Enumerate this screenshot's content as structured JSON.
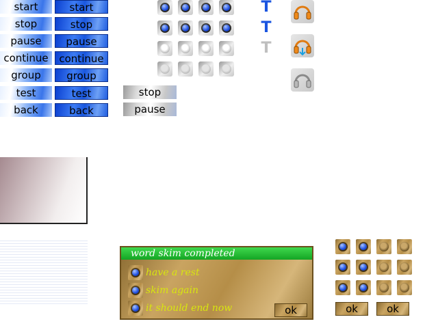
{
  "blue_buttons": {
    "left_column": [
      "start",
      "stop",
      "pause",
      "continue",
      "group",
      "test",
      "back"
    ],
    "right_column": [
      "start",
      "stop",
      "pause",
      "continue",
      "group",
      "test",
      "back"
    ]
  },
  "silver_buttons": [
    "stop",
    "pause"
  ],
  "radio_states": {
    "rows": [
      [
        "selected",
        "selected",
        "selected",
        "selected"
      ],
      [
        "selected",
        "selected",
        "selected",
        "selected"
      ],
      [
        "empty",
        "empty",
        "empty",
        "empty"
      ],
      [
        "disabled",
        "disabled",
        "disabled",
        "disabled"
      ]
    ]
  },
  "t_icons": {
    "glyph": "T",
    "states": [
      "normal",
      "hover",
      "disabled"
    ],
    "colors": [
      "#1a55e0",
      "#1a55e0",
      "#bfbfbf"
    ]
  },
  "headphone_icons": [
    "headphones-orange-icon",
    "headphones-orange-cursor-icon",
    "headphones-gray-icon"
  ],
  "dialog": {
    "title": "word skim completed",
    "options": [
      "have a rest",
      "skim again",
      "it should end now"
    ],
    "ok_label": "ok"
  },
  "gold_radios": {
    "rows": [
      [
        "selected",
        "selected",
        "empty",
        "empty"
      ],
      [
        "selected",
        "selected",
        "empty",
        "empty"
      ],
      [
        "selected",
        "selected",
        "empty",
        "empty"
      ]
    ]
  },
  "gold_buttons": [
    "ok",
    "ok"
  ],
  "colors": {
    "blue_button": "#1f5be0",
    "dialog_title_bar": "#1fb12e",
    "dialog_option_text": "#d8e60f",
    "wood": "#b8924f"
  }
}
